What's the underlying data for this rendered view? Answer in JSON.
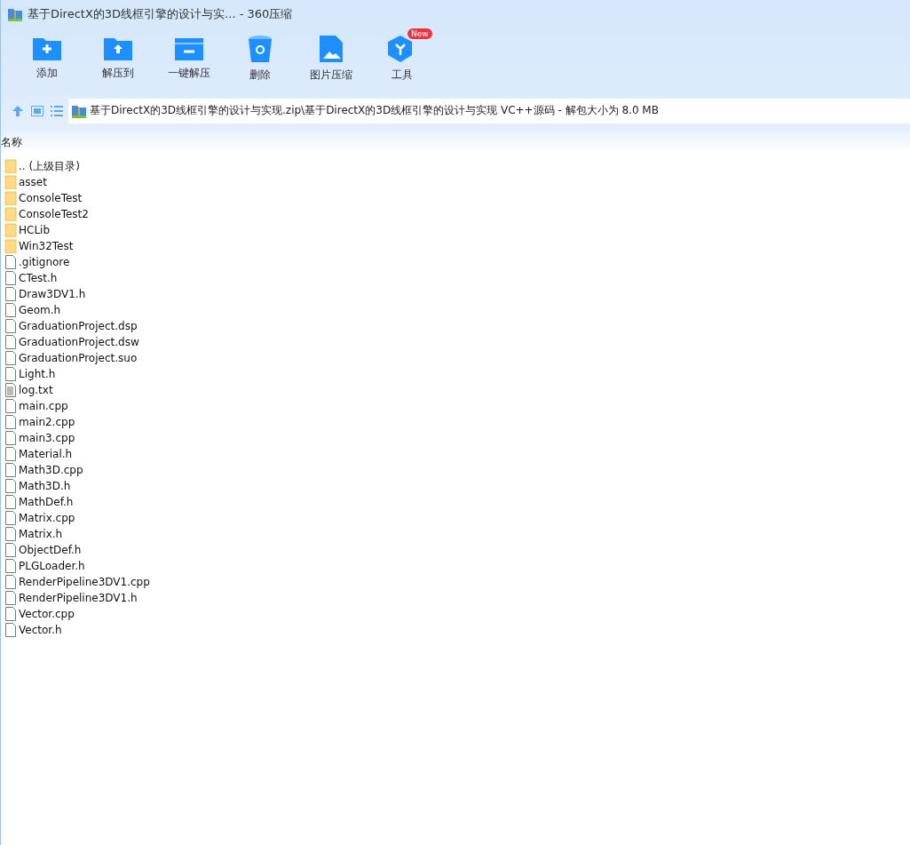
{
  "window": {
    "title": "基于DirectX的3D线框引擎的设计与实... - 360压缩"
  },
  "toolbar": [
    {
      "kind": "add",
      "label": "添加"
    },
    {
      "kind": "extract",
      "label": "解压到"
    },
    {
      "kind": "oneclick",
      "label": "一键解压"
    },
    {
      "kind": "delete",
      "label": "删除"
    },
    {
      "kind": "image",
      "label": "图片压缩"
    },
    {
      "kind": "tools",
      "label": "工具",
      "badge": "New"
    }
  ],
  "address": {
    "path": "基于DirectX的3D线框引擎的设计与实现.zip\\基于DirectX的3D线框引擎的设计与实现 VC++源码 - 解包大小为 8.0 MB"
  },
  "table": {
    "columns": [
      "名称"
    ],
    "rows": [
      {
        "kind": "folder",
        "name": ".. (上级目录)"
      },
      {
        "kind": "folder",
        "name": "asset"
      },
      {
        "kind": "folder",
        "name": "ConsoleTest"
      },
      {
        "kind": "folder",
        "name": "ConsoleTest2"
      },
      {
        "kind": "folder",
        "name": "HCLib"
      },
      {
        "kind": "folder",
        "name": "Win32Test"
      },
      {
        "kind": "file",
        "name": ".gitignore"
      },
      {
        "kind": "file",
        "name": "CTest.h"
      },
      {
        "kind": "file",
        "name": "Draw3DV1.h"
      },
      {
        "kind": "file",
        "name": "Geom.h"
      },
      {
        "kind": "file",
        "name": "GraduationProject.dsp"
      },
      {
        "kind": "file",
        "name": "GraduationProject.dsw"
      },
      {
        "kind": "file",
        "name": "GraduationProject.suo"
      },
      {
        "kind": "file",
        "name": "Light.h"
      },
      {
        "kind": "text",
        "name": "log.txt"
      },
      {
        "kind": "file",
        "name": "main.cpp"
      },
      {
        "kind": "file",
        "name": "main2.cpp"
      },
      {
        "kind": "file",
        "name": "main3.cpp"
      },
      {
        "kind": "file",
        "name": "Material.h"
      },
      {
        "kind": "file",
        "name": "Math3D.cpp"
      },
      {
        "kind": "file",
        "name": "Math3D.h"
      },
      {
        "kind": "file",
        "name": "MathDef.h"
      },
      {
        "kind": "file",
        "name": "Matrix.cpp"
      },
      {
        "kind": "file",
        "name": "Matrix.h"
      },
      {
        "kind": "file",
        "name": "ObjectDef.h"
      },
      {
        "kind": "file",
        "name": "PLGLoader.h"
      },
      {
        "kind": "file",
        "name": "RenderPipeline3DV1.cpp"
      },
      {
        "kind": "file",
        "name": "RenderPipeline3DV1.h"
      },
      {
        "kind": "file",
        "name": "Vector.cpp"
      },
      {
        "kind": "file",
        "name": "Vector.h"
      }
    ]
  }
}
